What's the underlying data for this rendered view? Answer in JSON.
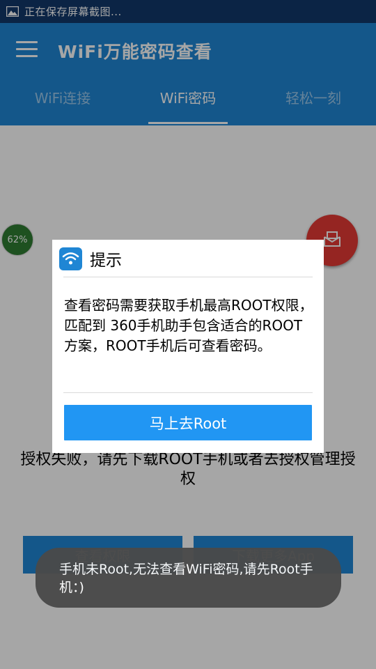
{
  "status_bar": {
    "text": "正在保存屏幕截图...",
    "icon": "image-icon"
  },
  "app_bar": {
    "title": "WiFi万能密码查看",
    "menu_icon": "hamburger-menu-icon"
  },
  "tabs": [
    {
      "label": "WiFi连接",
      "active": false
    },
    {
      "label": "WiFi密码",
      "active": true
    },
    {
      "label": "轻松一刻",
      "active": false
    }
  ],
  "main": {
    "fail_text": "授权失败，请先下载ROOT手机或者去授权管理授权",
    "button_left": "查看权限",
    "button_right": "下载更多App",
    "progress_label": "62%",
    "progress_value": 0.62,
    "fab_icon": "message-icon"
  },
  "dialog": {
    "title": "提示",
    "icon": "wifi-icon",
    "message": "查看密码需要获取手机最高ROOT权限，匹配到 360手机助手包含适合的ROOT方案，ROOT手机后可查看密码。",
    "button": "马上去Root"
  },
  "toast": {
    "text": "手机未Root,无法查看WiFi密码,请先Root手机：)"
  },
  "colors": {
    "primary": "#1f86d4",
    "status_bar": "#12386a",
    "dialog_button": "#2196f3",
    "fab": "#e53935",
    "progress": "#2e7d32"
  }
}
